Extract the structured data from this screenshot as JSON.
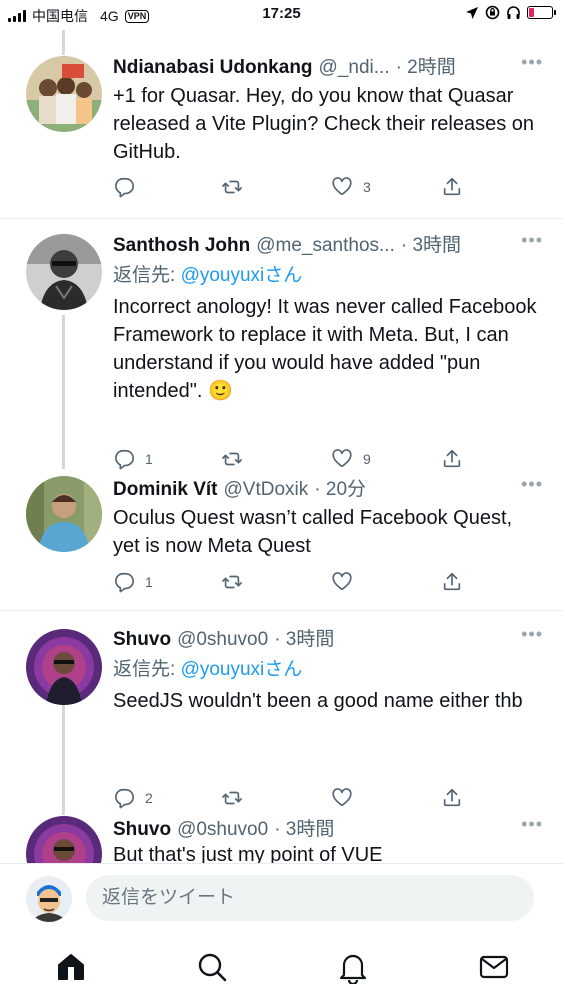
{
  "status_bar": {
    "carrier": "中国电信",
    "network": "4G",
    "vpn": "VPN",
    "time": "17:25",
    "battery_level": 0.2
  },
  "tweets": [
    {
      "name": "Ndianabasi Udonkang",
      "handle": "@_ndi...",
      "time": "· 2時間",
      "reply_prefix": "",
      "reply_user": "",
      "reply_suffix": "",
      "text": "+1 for Quasar. Hey, do you know that Quasar released a Vite Plugin? Check their releases on GitHub.",
      "replies": "",
      "likes": "3"
    },
    {
      "name": "Santhosh John",
      "handle": "@me_santhos...",
      "time": "· 3時間",
      "reply_prefix": "返信先: ",
      "reply_user": "@youyuxi",
      "reply_suffix": "さん",
      "text": "Incorrect anology! It was never called Facebook Framework to replace it with Meta. But, I can understand if you would have added \"pun intended\". 🙂",
      "replies": "1",
      "likes": "9"
    },
    {
      "name": "Dominik Vít",
      "handle": "@VtDoxik",
      "time": "· 20分",
      "reply_prefix": "",
      "reply_user": "",
      "reply_suffix": "",
      "text": "Oculus Quest wasn’t called Facebook Quest, yet is now Meta Quest",
      "replies": "1",
      "likes": ""
    },
    {
      "name": "Shuvo",
      "handle": "@0shuvo0",
      "time": "· 3時間",
      "reply_prefix": "返信先: ",
      "reply_user": "@youyuxi",
      "reply_suffix": "さん",
      "text": "SeedJS wouldn't been a good name either thb",
      "replies": "2",
      "likes": ""
    },
    {
      "name": "Shuvo",
      "handle": "@0shuvo0",
      "time": "· 3時間",
      "reply_prefix": "",
      "reply_user": "",
      "reply_suffix": "",
      "text": "But that's just my point of VUE",
      "replies": "",
      "likes": ""
    }
  ],
  "reply_bar": {
    "placeholder": "返信をツイート"
  },
  "icons": {
    "reply": "reply-icon",
    "retweet": "retweet-icon",
    "like": "heart-icon",
    "share": "share-icon",
    "more": "more-icon",
    "home": "home-icon",
    "search": "search-icon",
    "notifications": "bell-icon",
    "messages": "envelope-icon"
  },
  "colors": {
    "link": "#1d9bf0",
    "secondary_text": "#536471",
    "thread_line": "#cfd9de"
  }
}
